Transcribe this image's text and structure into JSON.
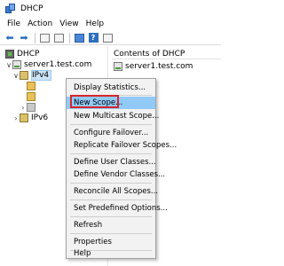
{
  "window": {
    "title": "DHCP",
    "icon": "dhcp-icon"
  },
  "menubar": {
    "items": [
      "File",
      "Action",
      "View",
      "Help"
    ]
  },
  "toolbar": {
    "buttons": [
      "back-icon",
      "forward-icon",
      "up-icon",
      "show-hide-tree-icon",
      "properties-icon",
      "help-icon",
      "export-icon"
    ]
  },
  "tree": {
    "root": "DHCP",
    "server": "server1.test.com",
    "ipv4": "IPv4",
    "ipv6": "IPv6"
  },
  "right_pane": {
    "header": "Contents of DHCP",
    "item": "server1.test.com"
  },
  "context_menu": {
    "items": [
      "Display Statistics...",
      "New Scope...",
      "New Multicast Scope...",
      "Configure Failover...",
      "Replicate Failover Scopes...",
      "Define User Classes...",
      "Define Vendor Classes...",
      "Reconcile All Scopes...",
      "Set Predefined Options...",
      "Refresh",
      "Properties",
      "Help"
    ],
    "highlighted": "New Scope...",
    "highlight_color": "#91c9f7",
    "annotation_color": "#d6262b"
  }
}
